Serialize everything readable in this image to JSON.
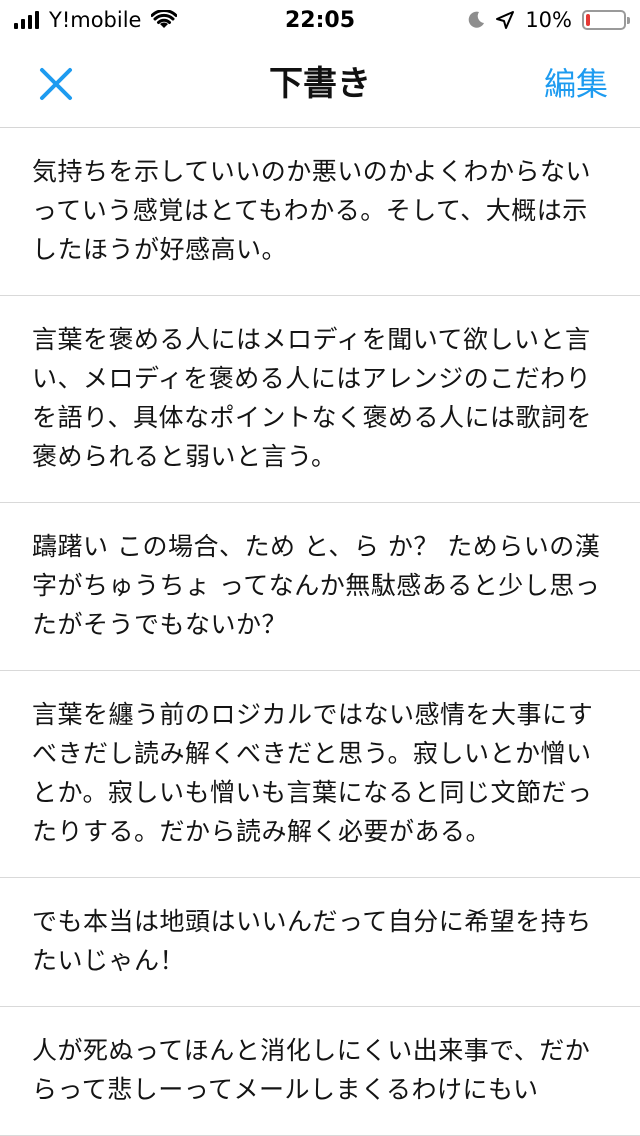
{
  "status_bar": {
    "carrier": "Y!mobile",
    "time": "22:05",
    "battery_percent": "10%",
    "battery_level": 0.1,
    "battery_color": "#e53935",
    "icons": [
      "signal-icon",
      "wifi-icon",
      "moon-icon",
      "location-arrow-icon",
      "battery-icon"
    ]
  },
  "nav": {
    "title": "下書き",
    "edit_label": "編集",
    "accent_color": "#1d9bf0",
    "close_icon": "close-icon"
  },
  "drafts": [
    {
      "text": "気持ちを示していいのか悪いのかよくわからないっていう感覚はとてもわかる。そして、大概は示したほうが好感高い。"
    },
    {
      "text": "言葉を褒める人にはメロディを聞いて欲しいと言い、メロディを褒める人にはアレンジのこだわりを語り、具体なポイントなく褒める人には歌詞を褒められると弱いと言う。"
    },
    {
      "text": "躊躇い この場合、ため と、ら か？ ためらいの漢字がちゅうちょ ってなんか無駄感あると少し思ったがそうでもないか？"
    },
    {
      "text": "言葉を纏う前のロジカルではない感情を大事にすべきだし読み解くべきだと思う。寂しいとか憎いとか。寂しいも憎いも言葉になると同じ文節だったりする。だから読み解く必要がある。"
    },
    {
      "text": "でも本当は地頭はいいんだって自分に希望を持ちたいじゃん！"
    },
    {
      "text": "人が死ぬってほんと消化しにくい出来事で、だからって悲しーってメールしまくるわけにもい"
    }
  ]
}
